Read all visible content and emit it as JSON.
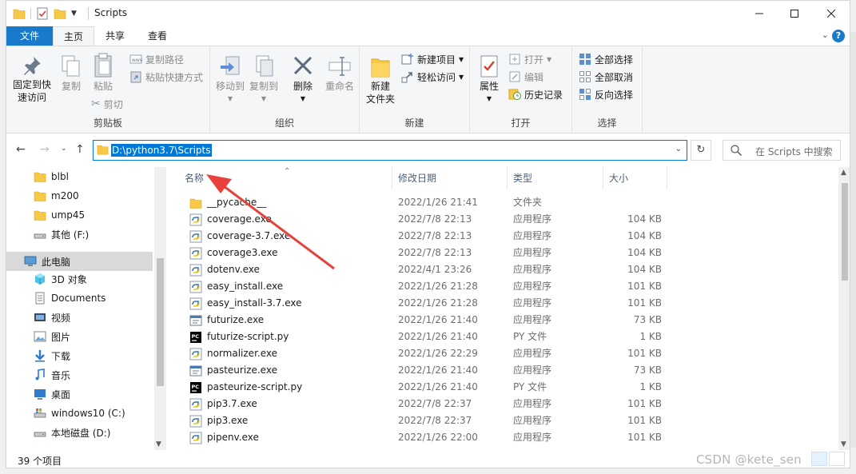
{
  "window": {
    "title": "Scripts"
  },
  "tabs": [
    {
      "label": "文件"
    },
    {
      "label": "主页"
    },
    {
      "label": "共享"
    },
    {
      "label": "查看"
    }
  ],
  "ribbon": {
    "clipboard": {
      "label": "剪贴板",
      "pin": "固定到快速访问",
      "pin_line1": "固定到快",
      "pin_line2": "速访问",
      "copy": "复制",
      "paste": "粘贴",
      "copy_path": "复制路径",
      "paste_shortcut": "粘贴快捷方式",
      "cut": "剪切"
    },
    "organize": {
      "label": "组织",
      "move_to": "移动到",
      "copy_to": "复制到",
      "delete": "删除",
      "rename": "重命名"
    },
    "new": {
      "label": "新建",
      "new_folder_line1": "新建",
      "new_folder_line2": "文件夹",
      "new_item": "新建项目",
      "easy_access": "轻松访问"
    },
    "open": {
      "label": "打开",
      "properties": "属性",
      "open": "打开",
      "edit": "编辑",
      "history": "历史记录"
    },
    "select": {
      "label": "选择",
      "select_all": "全部选择",
      "select_none": "全部取消",
      "invert": "反向选择"
    }
  },
  "address": {
    "path": "D:\\python3.7\\Scripts"
  },
  "search": {
    "placeholder": "在 Scripts 中搜索"
  },
  "sidebar": [
    {
      "label": "blbl",
      "icon": "folder-icon"
    },
    {
      "label": "m200",
      "icon": "folder-icon"
    },
    {
      "label": "ump45",
      "icon": "folder-icon"
    },
    {
      "label": "其他 (F:)",
      "icon": "drive-icon"
    },
    {
      "label": "此电脑",
      "icon": "computer-icon"
    },
    {
      "label": "3D 对象",
      "icon": "cube-icon"
    },
    {
      "label": "Documents",
      "icon": "document-icon"
    },
    {
      "label": "视频",
      "icon": "video-icon"
    },
    {
      "label": "图片",
      "icon": "picture-icon"
    },
    {
      "label": "下载",
      "icon": "download-icon"
    },
    {
      "label": "音乐",
      "icon": "music-icon"
    },
    {
      "label": "桌面",
      "icon": "desktop-icon"
    },
    {
      "label": "windows10 (C:)",
      "icon": "system-drive-icon"
    },
    {
      "label": "本地磁盘 (D:)",
      "icon": "drive-icon"
    }
  ],
  "columns": {
    "name": "名称",
    "date": "修改日期",
    "type": "类型",
    "size": "大小"
  },
  "files": [
    {
      "name": "__pycache__",
      "date": "2022/1/26 21:41",
      "type": "文件夹",
      "size": "",
      "icon": "folder-icon"
    },
    {
      "name": "coverage.exe",
      "date": "2022/7/8 22:13",
      "type": "应用程序",
      "size": "104 KB",
      "icon": "python-exe-icon"
    },
    {
      "name": "coverage-3.7.exe",
      "date": "2022/7/8 22:13",
      "type": "应用程序",
      "size": "104 KB",
      "icon": "python-exe-icon"
    },
    {
      "name": "coverage3.exe",
      "date": "2022/7/8 22:13",
      "type": "应用程序",
      "size": "104 KB",
      "icon": "python-exe-icon"
    },
    {
      "name": "dotenv.exe",
      "date": "2022/4/1 23:26",
      "type": "应用程序",
      "size": "104 KB",
      "icon": "python-exe-icon"
    },
    {
      "name": "easy_install.exe",
      "date": "2022/1/26 21:28",
      "type": "应用程序",
      "size": "101 KB",
      "icon": "python-exe-icon"
    },
    {
      "name": "easy_install-3.7.exe",
      "date": "2022/1/26 21:28",
      "type": "应用程序",
      "size": "101 KB",
      "icon": "python-exe-icon"
    },
    {
      "name": "futurize.exe",
      "date": "2022/1/26 21:40",
      "type": "应用程序",
      "size": "73 KB",
      "icon": "window-exe-icon"
    },
    {
      "name": "futurize-script.py",
      "date": "2022/1/26 21:40",
      "type": "PY 文件",
      "size": "1 KB",
      "icon": "pycharm-file-icon"
    },
    {
      "name": "normalizer.exe",
      "date": "2022/1/26 22:29",
      "type": "应用程序",
      "size": "101 KB",
      "icon": "python-exe-icon"
    },
    {
      "name": "pasteurize.exe",
      "date": "2022/1/26 21:40",
      "type": "应用程序",
      "size": "73 KB",
      "icon": "window-exe-icon"
    },
    {
      "name": "pasteurize-script.py",
      "date": "2022/1/26 21:40",
      "type": "PY 文件",
      "size": "1 KB",
      "icon": "pycharm-file-icon"
    },
    {
      "name": "pip3.7.exe",
      "date": "2022/7/8 22:37",
      "type": "应用程序",
      "size": "101 KB",
      "icon": "python-exe-icon"
    },
    {
      "name": "pip3.exe",
      "date": "2022/7/8 22:37",
      "type": "应用程序",
      "size": "101 KB",
      "icon": "python-exe-icon"
    },
    {
      "name": "pipenv.exe",
      "date": "2022/1/26 22:00",
      "type": "应用程序",
      "size": "101 KB",
      "icon": "python-exe-icon"
    }
  ],
  "status": {
    "count": "39 个项目"
  },
  "watermark": "CSDN @kete_sen",
  "colors": {
    "accent": "#1979ca",
    "selection": "#0078d7",
    "folder": "#f7c948",
    "arrow": "#e8413c"
  }
}
